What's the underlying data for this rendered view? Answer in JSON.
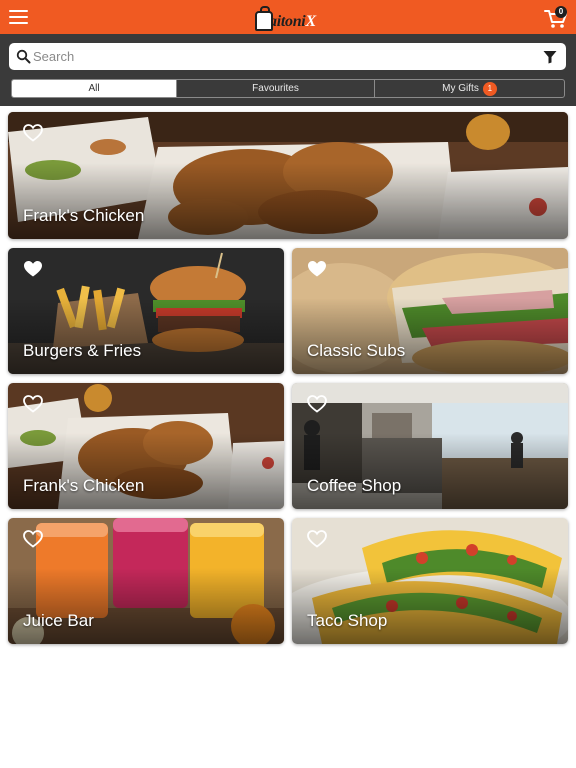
{
  "header": {
    "logo_text": "aitoni",
    "logo_accent": "X",
    "cart_count": "0",
    "menu_icon": "hamburger-icon",
    "cart_icon": "cart-icon",
    "brand_color": "#f05a22"
  },
  "search": {
    "placeholder": "Search",
    "value": "",
    "search_icon": "search-icon",
    "filter_icon": "filter-icon"
  },
  "tabs": [
    {
      "label": "All",
      "active": true
    },
    {
      "label": "Favourites",
      "active": false
    },
    {
      "label": "My Gifts",
      "active": false,
      "badge": "1"
    }
  ],
  "stores": [
    {
      "name": "Frank's Chicken",
      "favourite": false,
      "image": "fried chicken platter"
    },
    {
      "name": "Burgers & Fries",
      "favourite": true,
      "image": "burger and fries"
    },
    {
      "name": "Classic Subs",
      "favourite": true,
      "image": "sub sandwich"
    },
    {
      "name": "Frank's Chicken",
      "favourite": false,
      "image": "fried chicken platter"
    },
    {
      "name": "Coffee Shop",
      "favourite": false,
      "image": "cafe interior"
    },
    {
      "name": "Juice Bar",
      "favourite": false,
      "image": "fresh juices"
    },
    {
      "name": "Taco Shop",
      "favourite": false,
      "image": "tacos"
    }
  ]
}
